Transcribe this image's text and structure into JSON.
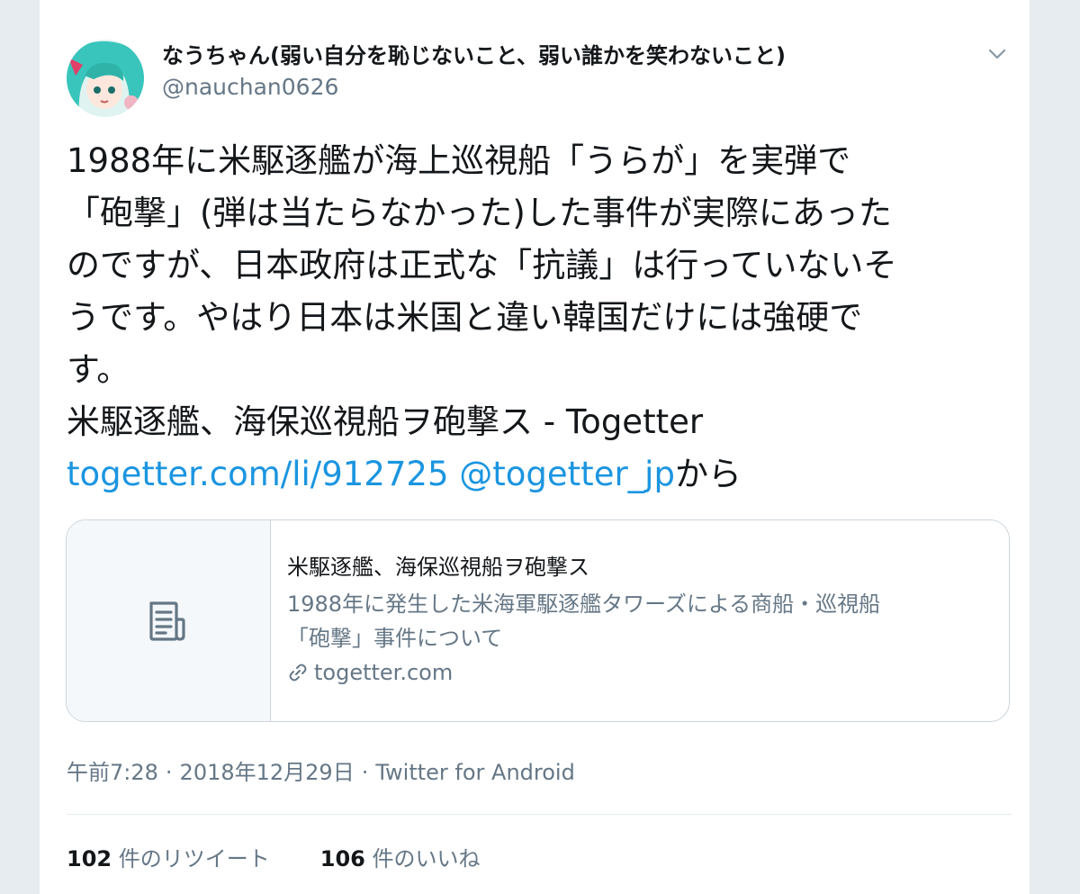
{
  "author": {
    "display_name": "なうちゃん(弱い自分を恥じないこと、弱い誰かを笑わないこと)",
    "handle": "@nauchan0626",
    "avatar_icon": "avatar-anime-character"
  },
  "tweet": {
    "lines": [
      "1988年に米駆逐艦が海上巡視船「うらが」を実弾で",
      "「砲撃」(弾は当たらなかった)した事件が実際にあった",
      "のですが、日本政府は正式な「抗議」は行っていないそ",
      "うです。やはり日本は米国と違い韓国だけには強硬で",
      "す。",
      "米駆逐艦、海保巡視船ヲ砲撃ス - Togetter"
    ],
    "link_url": "togetter.com/li/912725",
    "mention": "@togetter_jp",
    "suffix": "から"
  },
  "card": {
    "title": "米駆逐艦、海保巡視船ヲ砲撃ス",
    "description_lines": [
      "1988年に発生した米海軍駆逐艦タワーズによる商船・巡視船",
      "「砲撃」事件について"
    ],
    "domain": "togetter.com",
    "thumbnail_icon": "document-icon"
  },
  "meta": {
    "time": "午前7:28",
    "separator": "·",
    "date": "2018年12月29日",
    "source": "Twitter for Android"
  },
  "stats": {
    "retweet_count": "102",
    "retweet_label": "件のリツイート",
    "like_count": "106",
    "like_label": "件のいいね"
  },
  "colors": {
    "link": "#1b95e0",
    "text": "#14171a",
    "secondary": "#657786",
    "border": "#ccd6dd",
    "page_bg": "#e6ecf0"
  }
}
